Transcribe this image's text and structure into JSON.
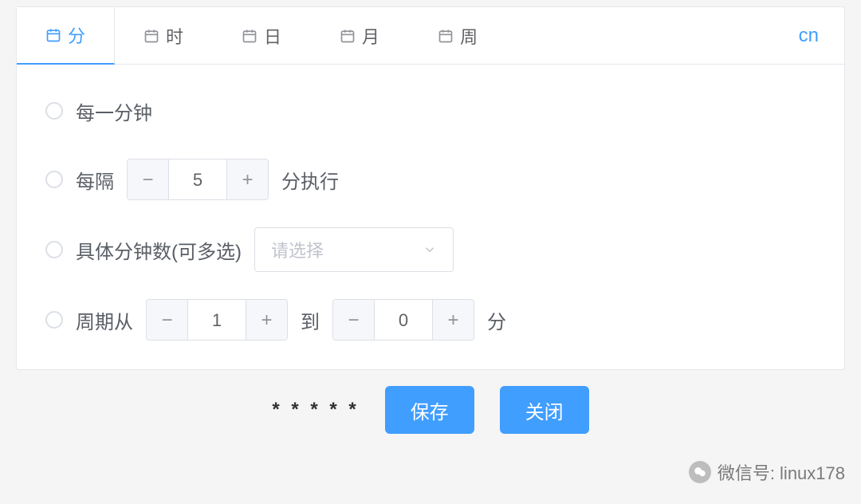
{
  "tabs": {
    "minute": "分",
    "hour": "时",
    "day": "日",
    "month": "月",
    "week": "周"
  },
  "lang": "cn",
  "options": {
    "every_minute": "每一分钟",
    "interval_prefix": "每隔",
    "interval_value": "5",
    "interval_suffix": "分执行",
    "specific_label": "具体分钟数(可多选)",
    "specific_placeholder": "请选择",
    "cycle_prefix": "周期从",
    "cycle_from": "1",
    "cycle_mid": "到",
    "cycle_to": "0",
    "cycle_suffix": "分"
  },
  "footer": {
    "expression": "* * * * *",
    "save": "保存",
    "close": "关闭"
  },
  "watermark": "微信号: linux178"
}
